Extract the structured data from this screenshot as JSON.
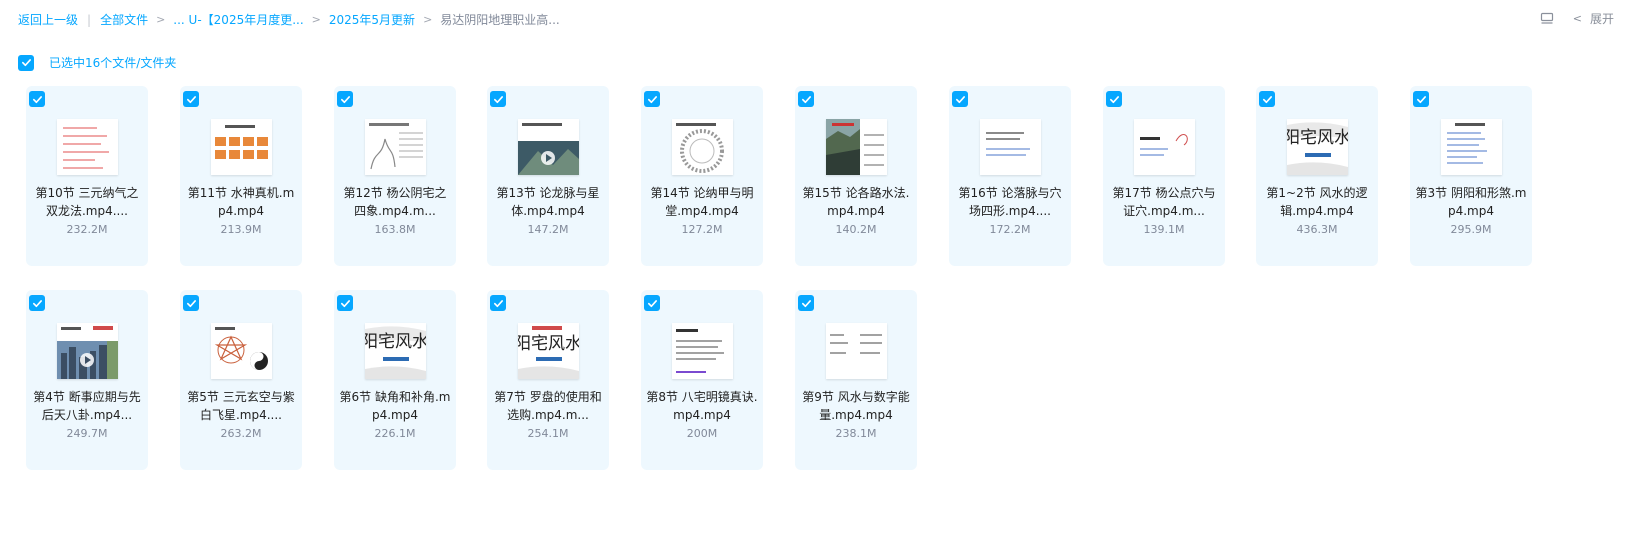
{
  "breadcrumb": {
    "back": "返回上一级",
    "all_files": "全部文件",
    "ellipsis_folder": "... U-【2025年月度更...",
    "month_folder": "2025年5月更新",
    "current": "易达阴阳地理职业高..."
  },
  "toolbar": {
    "expand_label": "展开"
  },
  "selection": {
    "label": "已选中16个文件/文件夹"
  },
  "accent_color": "#06a7ff",
  "files": [
    {
      "name": "第10节 三元纳气之双龙法.mp4....",
      "size": "232.2M",
      "thumb": "text-red"
    },
    {
      "name": "第11节 水神真机.mp4.mp4",
      "size": "213.9M",
      "thumb": "orange-grid"
    },
    {
      "name": "第12节 杨公阴宅之四象.mp4.m...",
      "size": "163.8M",
      "thumb": "sketch"
    },
    {
      "name": "第13节 论龙脉与星体.mp4.mp4",
      "size": "147.2M",
      "thumb": "video-dark"
    },
    {
      "name": "第14节 论纳甲与明堂.mp4.mp4",
      "size": "127.2M",
      "thumb": "compass"
    },
    {
      "name": "第15节 论各路水法.mp4.mp4",
      "size": "140.2M",
      "thumb": "landscape"
    },
    {
      "name": "第16节 论落脉与穴场四形.mp4....",
      "size": "172.2M",
      "thumb": "text-blue"
    },
    {
      "name": "第17节 杨公点穴与证穴.mp4.m...",
      "size": "139.1M",
      "thumb": "text-sketch"
    },
    {
      "name": "第1~2节 风水的逻辑.mp4.mp4",
      "size": "436.3M",
      "thumb": "calligraphy"
    },
    {
      "name": "第3节 阴阳和形煞.mp4.mp4",
      "size": "295.9M",
      "thumb": "text-list"
    },
    {
      "name": "第4节 断事应期与先后天八卦.mp4...",
      "size": "249.7M",
      "thumb": "city"
    },
    {
      "name": "第5节 三元玄空与紫白飞星.mp4....",
      "size": "263.2M",
      "thumb": "taiji"
    },
    {
      "name": "第6节 缺角和补角.mp4.mp4",
      "size": "226.1M",
      "thumb": "calligraphy"
    },
    {
      "name": "第7节 罗盘的使用和选购.mp4.m...",
      "size": "254.1M",
      "thumb": "calligraphy-red"
    },
    {
      "name": "第8节 八宅明镜真诀.mp4.mp4",
      "size": "200M",
      "thumb": "text-list2"
    },
    {
      "name": "第9节 风水与数字能量.mp4.mp4",
      "size": "238.1M",
      "thumb": "text-cols"
    }
  ]
}
